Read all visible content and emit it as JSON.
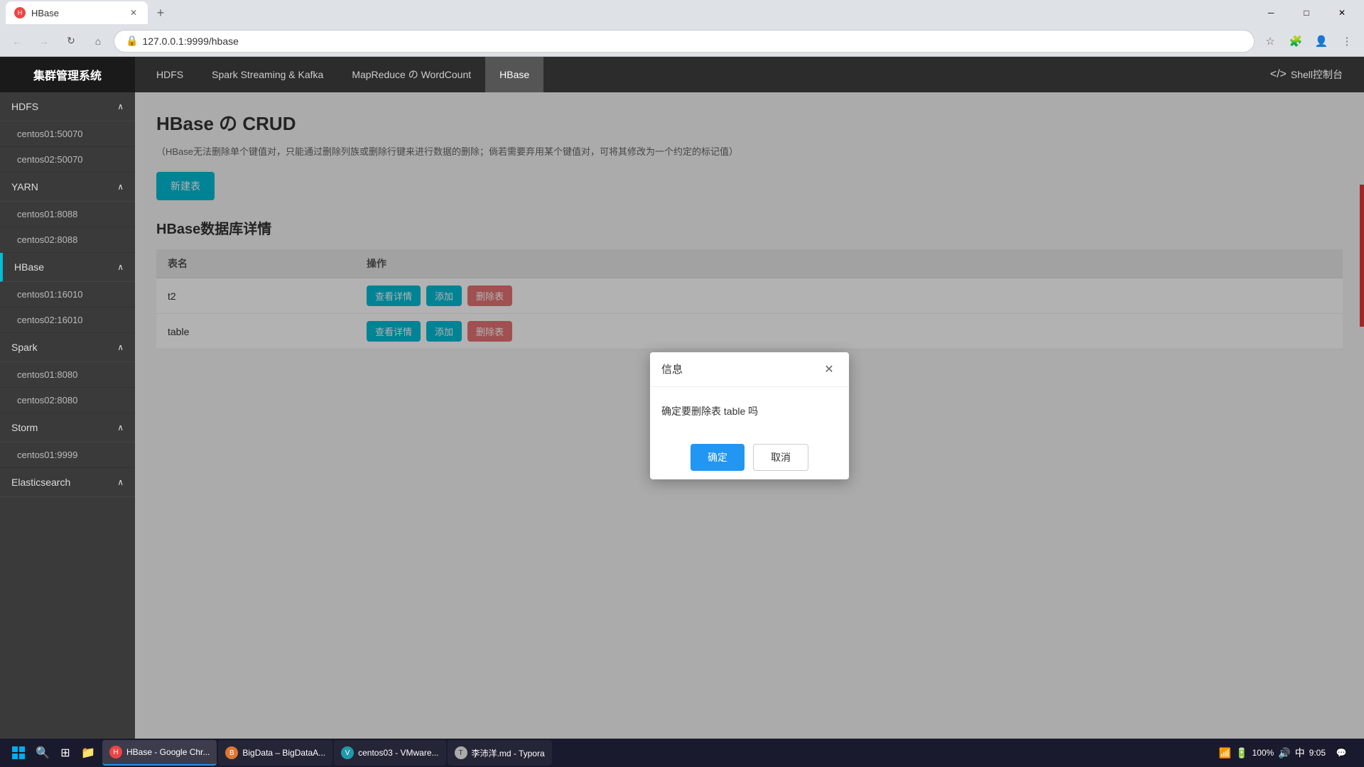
{
  "browser": {
    "tab_title": "HBase",
    "address": "127.0.0.1:9999/hbase",
    "new_tab_symbol": "+"
  },
  "app": {
    "brand": "集群管理系统",
    "shell_label": "Shell控制台",
    "nav": [
      {
        "id": "hdfs",
        "label": "HDFS"
      },
      {
        "id": "spark",
        "label": "Spark Streaming & Kafka"
      },
      {
        "id": "mapreduce",
        "label": "MapReduce の WordCount"
      },
      {
        "id": "hbase",
        "label": "HBase"
      }
    ]
  },
  "sidebar": {
    "sections": [
      {
        "id": "hdfs",
        "label": "HDFS",
        "items": [
          {
            "label": "centos01:50070"
          },
          {
            "label": "centos02:50070"
          }
        ]
      },
      {
        "id": "yarn",
        "label": "YARN",
        "items": [
          {
            "label": "centos01:8088"
          },
          {
            "label": "centos02:8088"
          }
        ]
      },
      {
        "id": "hbase",
        "label": "HBase",
        "items": [
          {
            "label": "centos01:16010"
          },
          {
            "label": "centos02:16010"
          }
        ]
      },
      {
        "id": "spark",
        "label": "Spark",
        "items": [
          {
            "label": "centos01:8080"
          },
          {
            "label": "centos02:8080"
          }
        ]
      },
      {
        "id": "storm",
        "label": "Storm",
        "items": [
          {
            "label": "centos01:9999"
          }
        ]
      },
      {
        "id": "elasticsearch",
        "label": "Elasticsearch",
        "items": []
      }
    ]
  },
  "main": {
    "page_title": "HBase の CRUD",
    "notice": "（HBase无法删除单个键值对，只能通过删除列族或删除行键来进行数据的删除；倘若需要弃用某个键值对，可将其修改为一个约定的标记值）",
    "new_table_btn": "新建表",
    "db_section_title": "HBase数据库详情",
    "table_col_name": "表名",
    "table_col_ops": "操作",
    "rows": [
      {
        "name": "t2",
        "ops": [
          "查看详情",
          "添加",
          "删除表"
        ]
      },
      {
        "name": "table",
        "ops": [
          "查看详情",
          "添加",
          "删除表"
        ]
      }
    ]
  },
  "modal": {
    "title": "信息",
    "message": "确定要删除表 table 吗",
    "confirm_btn": "确定",
    "cancel_btn": "取消"
  },
  "taskbar": {
    "apps": [
      {
        "label": "HBase - Google Chr...",
        "icon_color": "#e44",
        "active": true
      },
      {
        "label": "BigData – BigDataA...",
        "icon_color": "#d73",
        "active": false
      },
      {
        "label": "centos03 - VMware...",
        "icon_color": "#29a",
        "active": false
      },
      {
        "label": "李沛洋.md - Typora",
        "icon_color": "#aaa",
        "active": false
      }
    ],
    "tray": {
      "battery": "100%",
      "time": "9:05"
    }
  }
}
